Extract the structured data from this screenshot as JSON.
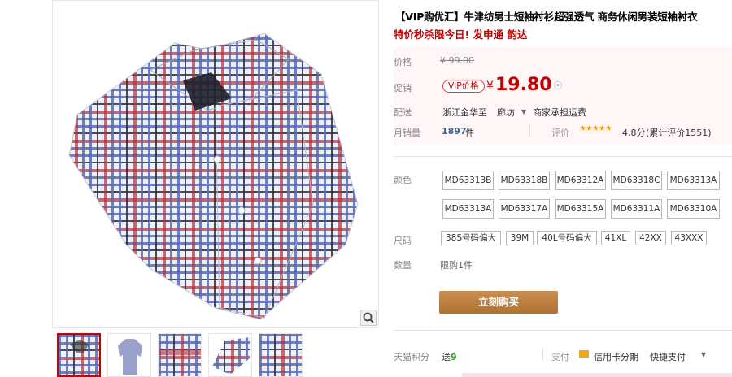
{
  "product": {
    "title": "【VIP购优汇】牛津纺男士短袖衬衫超强透气 商务休闲男装短袖衬衣",
    "promo": "特价秒杀限今日! 发申通 韵达"
  },
  "price": {
    "label_original": "价格",
    "original": "¥ 99.00",
    "label_promo": "促销",
    "vip_badge": "VIP价格",
    "yen": "¥",
    "value": "19.80"
  },
  "shipping": {
    "label": "配送",
    "from": "浙江金华",
    "to_word": "至",
    "destination": "廊坊",
    "fee": "商家承担运费"
  },
  "stats": {
    "sales_label": "月销量",
    "sales_count": "1897",
    "sales_unit": "件",
    "rating_label": "评价",
    "stars": "★★★★★",
    "rating_score": "4.8分",
    "review_count": "(累计评价1551)"
  },
  "colors": {
    "label": "颜色",
    "options": [
      "MD63313B",
      "MD63318B",
      "MD63312A",
      "MD63318C",
      "MD63313A",
      "MD63313A",
      "MD63317A",
      "MD63315A",
      "MD63311A",
      "MD63310A"
    ]
  },
  "sizes": {
    "label": "尺码",
    "options": [
      "38S号码偏大",
      "39M",
      "40L号码偏大",
      "41XL",
      "42XX",
      "43XXX"
    ]
  },
  "quantity": {
    "label": "数量",
    "value": "限购1件"
  },
  "buy_button": "立刻购买",
  "footer": {
    "points_label": "天猫积分",
    "points_prefix": "送",
    "points_value": "9",
    "pay_label": "支付",
    "pay_installment": "信用卡分期",
    "pay_quick": "快捷支付"
  },
  "accent_colors": {
    "price_red": "#c40000",
    "buy_button": "#b57a3d",
    "link_blue": "#3c6594"
  }
}
